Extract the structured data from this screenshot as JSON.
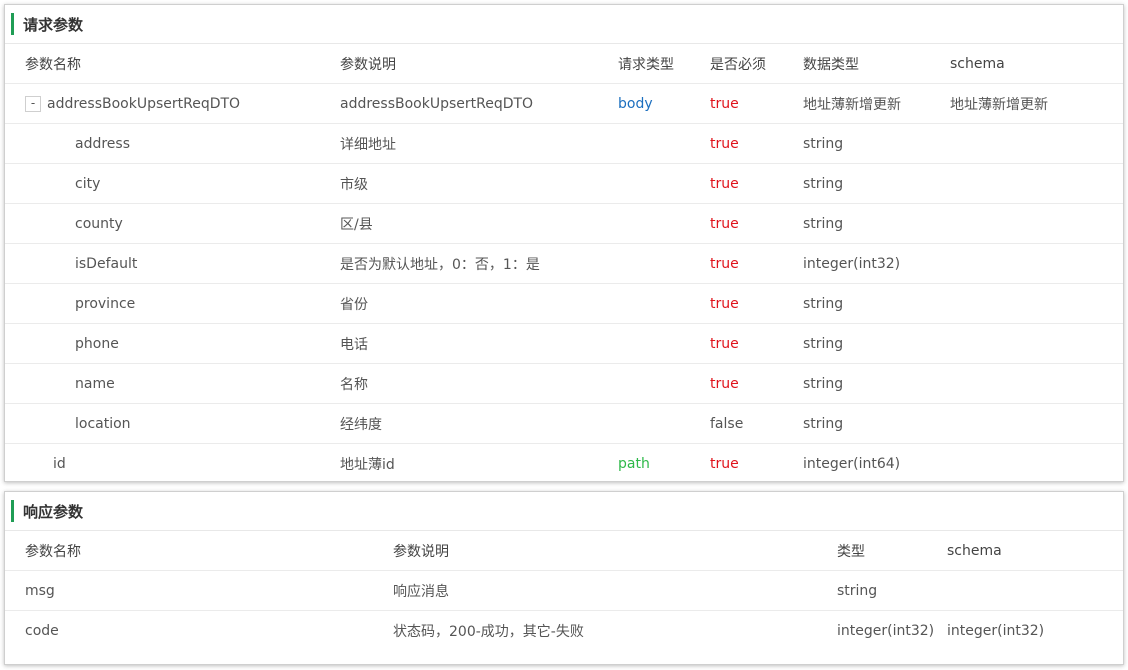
{
  "request": {
    "title": "请求参数",
    "headers": [
      "参数名称",
      "参数说明",
      "请求类型",
      "是否必须",
      "数据类型",
      "schema"
    ],
    "rows": [
      {
        "name": "addressBookUpsertReqDTO",
        "desc": "addressBookUpsertReqDTO",
        "in": "body",
        "required": "true",
        "type": "地址薄新增更新",
        "schema": "地址薄新增更新",
        "expander": "-"
      },
      {
        "name": "address",
        "desc": "详细地址",
        "in": "",
        "required": "true",
        "type": "string",
        "schema": ""
      },
      {
        "name": "city",
        "desc": "市级",
        "in": "",
        "required": "true",
        "type": "string",
        "schema": ""
      },
      {
        "name": "county",
        "desc": "区/县",
        "in": "",
        "required": "true",
        "type": "string",
        "schema": ""
      },
      {
        "name": "isDefault",
        "desc": "是否为默认地址，0：否，1：是",
        "in": "",
        "required": "true",
        "type": "integer(int32)",
        "schema": ""
      },
      {
        "name": "province",
        "desc": "省份",
        "in": "",
        "required": "true",
        "type": "string",
        "schema": ""
      },
      {
        "name": "phone",
        "desc": "电话",
        "in": "",
        "required": "true",
        "type": "string",
        "schema": ""
      },
      {
        "name": "name",
        "desc": "名称",
        "in": "",
        "required": "true",
        "type": "string",
        "schema": ""
      },
      {
        "name": "location",
        "desc": "经纬度",
        "in": "",
        "required": "false",
        "type": "string",
        "schema": ""
      },
      {
        "name": "id",
        "desc": "地址薄id",
        "in": "path",
        "required": "true",
        "type": "integer(int64)",
        "schema": ""
      }
    ]
  },
  "response": {
    "title": "响应参数",
    "headers": [
      "参数名称",
      "参数说明",
      "类型",
      "schema"
    ],
    "rows": [
      {
        "name": "msg",
        "desc": "响应消息",
        "type": "string",
        "schema": ""
      },
      {
        "name": "code",
        "desc": "状态码，200-成功，其它-失败",
        "type": "integer(int32)",
        "schema": "integer(int32)"
      }
    ]
  },
  "colors": {
    "accent": "#1f9d55",
    "in_body": "#1c6fbf",
    "in_path": "#2fb94a",
    "required_true": "#e0131b"
  }
}
